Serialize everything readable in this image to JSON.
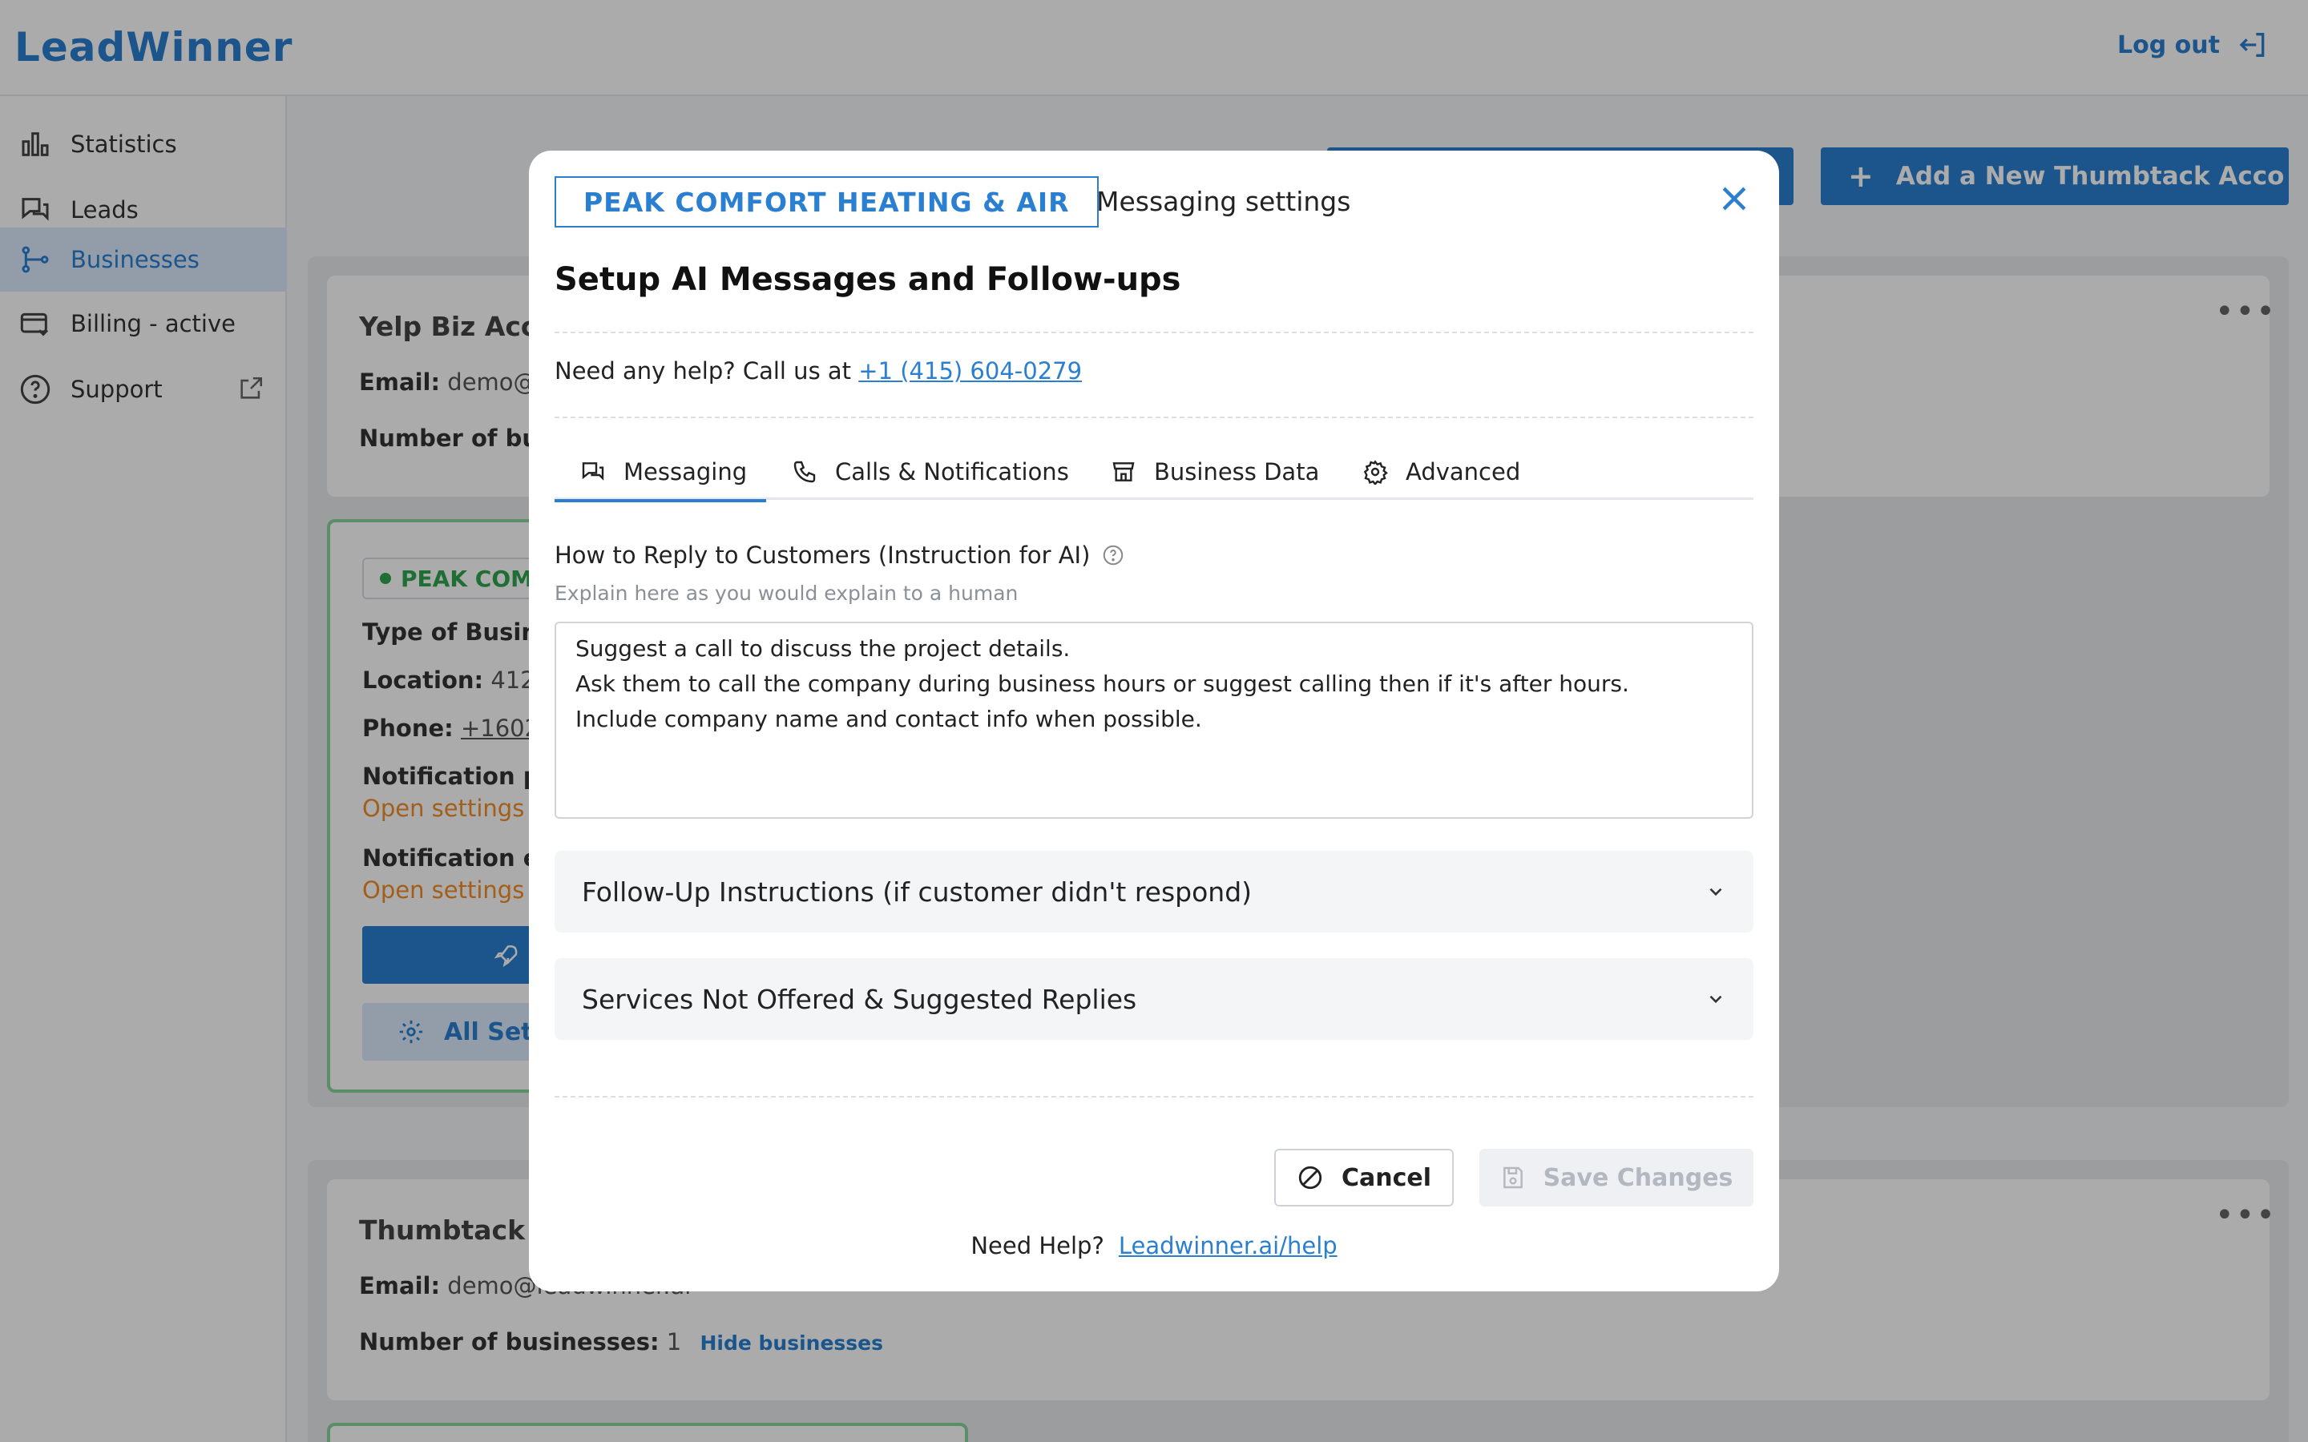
{
  "app": {
    "logo": "LeadWinner",
    "logout_label": "Log out"
  },
  "sidebar": {
    "items": [
      {
        "label": "Statistics",
        "icon": "bar-chart-icon"
      },
      {
        "label": "Leads",
        "icon": "chat-icon"
      },
      {
        "label": "Businesses",
        "icon": "hierarchy-icon"
      },
      {
        "label": "Billing - active",
        "icon": "billing-icon"
      },
      {
        "label": "Support",
        "icon": "help-circle-icon"
      }
    ]
  },
  "main": {
    "add_thumbtack_label": "Add a New Thumbtack Acco",
    "yelp_card": {
      "title": "Yelp Biz Acc",
      "email_label": "Email:",
      "email_value": "demo@",
      "businesses_label": "Number of bu"
    },
    "peak_card": {
      "badge": "PEAK COM",
      "type_label": "Type of Busin",
      "location_label": "Location:",
      "location_value": "412",
      "phone_label": "Phone:",
      "phone_value": "+1602",
      "notif_phone_label": "Notification p",
      "notif_phone_warning": "Open settings t",
      "notif_email_label": "Notification e",
      "notif_email_warning": "Open settings t",
      "all_settings_label": "All Sett"
    },
    "thumbtack_card": {
      "title": "Thumbtack",
      "email_label": "Email:",
      "email_value": "demo@leadwinner.ai",
      "businesses_label": "Number of businesses:",
      "businesses_count": "1",
      "hide_label": "Hide businesses"
    }
  },
  "modal": {
    "business_name": "PEAK COMFORT HEATING & AIR",
    "subtitle": "Messaging settings",
    "title": "Setup AI Messages and Follow-ups",
    "help_text": "Need any help? Call us at",
    "help_phone": "+1 (415) 604-0279",
    "tabs": [
      {
        "label": "Messaging",
        "icon": "chat-icon",
        "active": true
      },
      {
        "label": "Calls & Notifications",
        "icon": "phone-icon",
        "active": false
      },
      {
        "label": "Business Data",
        "icon": "store-icon",
        "active": false
      },
      {
        "label": "Advanced",
        "icon": "gear-icon",
        "active": false
      }
    ],
    "reply_label": "How to Reply to Customers (Instruction for AI)",
    "reply_hint": "Explain here as you would explain to a human",
    "reply_lines": [
      "Suggest a call to discuss the project details.",
      "Ask them to call the company during business hours or suggest calling then if it's after hours.",
      "Include company name and contact info when possible."
    ],
    "accordions": [
      "Follow-Up Instructions (if customer didn't respond)",
      "Services Not Offered & Suggested Replies"
    ],
    "cancel_label": "Cancel",
    "save_label": "Save Changes",
    "footer_help": "Need Help?",
    "footer_link": "Leadwinner.ai/help",
    "accent_color": "#2b7fd0"
  }
}
